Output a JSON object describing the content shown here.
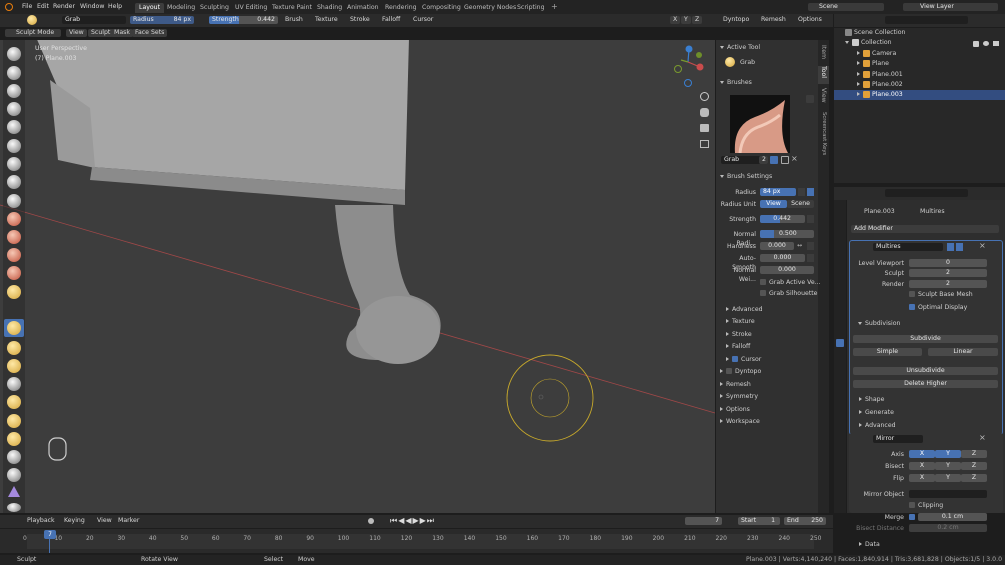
{
  "menu": [
    "File",
    "Edit",
    "Render",
    "Window",
    "Help"
  ],
  "workspaces": [
    "Layout",
    "Modeling",
    "Sculpting",
    "UV Editing",
    "Texture Paint",
    "Shading",
    "Animation",
    "Rendering",
    "Compositing",
    "Geometry Nodes",
    "Scripting"
  ],
  "scene": {
    "name": "Scene",
    "view_layer": "View Layer"
  },
  "tool_header": {
    "brush": "Grab",
    "radius_label": "Radius",
    "radius": "84 px",
    "strength_label": "Strength",
    "strength": "0.442",
    "menus": [
      "Brush",
      "Texture",
      "Stroke",
      "Falloff",
      "Cursor"
    ],
    "axes": [
      "X",
      "Y",
      "Z"
    ],
    "dyntopo": "Dyntopo",
    "remesh": "Remesh",
    "options": "Options"
  },
  "viewport_header": {
    "mode": "Sculpt Mode",
    "menus": [
      "View",
      "Sculpt",
      "Mask",
      "Face Sets"
    ]
  },
  "overlay": {
    "line1": "User Perspective",
    "line2": "(7) Plane.003"
  },
  "sidebar": {
    "tabs": [
      "Item",
      "Tool",
      "View",
      "Screencast Keys"
    ],
    "active_tool_title": "Active Tool",
    "active_tool": "Grab",
    "brushes_title": "Brushes",
    "brush_name": "Grab",
    "brush_users": "2",
    "brush_settings_title": "Brush Settings",
    "radius_label": "Radius",
    "radius": "84 px",
    "radius_unit_label": "Radius Unit",
    "unit_view": "View",
    "unit_scene": "Scene",
    "strength_label": "Strength",
    "strength": "0.442",
    "normal_radius_label": "Normal Radi...",
    "normal_radius": "0.500",
    "hardness_label": "Hardness",
    "hardness": "0.000",
    "autosmooth_label": "Auto-Smooth",
    "autosmooth": "0.000",
    "normal_weight_label": "Normal Wei...",
    "normal_weight": "0.000",
    "grab_active": "Grab Active Ve...",
    "grab_silhouette": "Grab Silhouette",
    "sub": [
      "Advanced",
      "Texture",
      "Stroke",
      "Falloff",
      "Cursor"
    ],
    "sections": [
      "Dyntopo",
      "Remesh",
      "Symmetry",
      "Options",
      "Workspace"
    ]
  },
  "outliner": {
    "root": "Scene Collection",
    "collection": "Collection",
    "items": [
      "Camera",
      "Plane",
      "Plane.001",
      "Plane.002",
      "Plane.003"
    ]
  },
  "properties": {
    "object": "Plane.003",
    "modifier_tab": "Multires",
    "add_modifier": "Add Modifier",
    "multires_name": "Multires",
    "level_viewport_label": "Level Viewport",
    "level_viewport": "0",
    "sculpt_label": "Sculpt",
    "sculpt": "2",
    "render_label": "Render",
    "render": "2",
    "sculpt_base_mesh": "Sculpt Base Mesh",
    "optimal_display": "Optimal Display",
    "subdivision": "Subdivision",
    "subdivide": "Subdivide",
    "simple": "Simple",
    "linear": "Linear",
    "unsubdivide": "Unsubdivide",
    "delete_higher": "Delete Higher",
    "shape": "Shape",
    "generate": "Generate",
    "advanced": "Advanced",
    "mirror_name": "Mirror",
    "axis_label": "Axis",
    "bisect_label": "Bisect",
    "flip_label": "Flip",
    "xyz": [
      "X",
      "Y",
      "Z"
    ],
    "mirror_object_label": "Mirror Object",
    "clipping": "Clipping",
    "merge_label": "Merge",
    "merge": "0.1 cm",
    "bisect_distance_label": "Bisect Distance",
    "bisect_distance": "0.2 cm",
    "data": "Data"
  },
  "timeline": {
    "menus": [
      "Playback",
      "Keying",
      "View",
      "Marker"
    ],
    "frame": "7",
    "start_label": "Start",
    "start": "1",
    "end_label": "End",
    "end": "250",
    "current": "7",
    "ticks": [
      "0",
      "10",
      "20",
      "30",
      "40",
      "50",
      "60",
      "70",
      "80",
      "90",
      "100",
      "110",
      "120",
      "130",
      "140",
      "150",
      "160",
      "170",
      "180",
      "190",
      "200",
      "210",
      "220",
      "230",
      "240",
      "250"
    ]
  },
  "status": {
    "left": "Sculpt",
    "middle": "Rotate View",
    "select": "Select",
    "move": "Move",
    "right": "Plane.003 | Verts:4,140,240 | Faces:1,840,914 | Tris:3,681,828 | Objects:1/5 | 3.0.0"
  },
  "colors": {
    "accent": "#4772b3",
    "cursor": "#c7a92b",
    "axis_x": "#c94c4c",
    "axis_y": "#7a9a2e",
    "axis_z": "#3a7fd1"
  }
}
